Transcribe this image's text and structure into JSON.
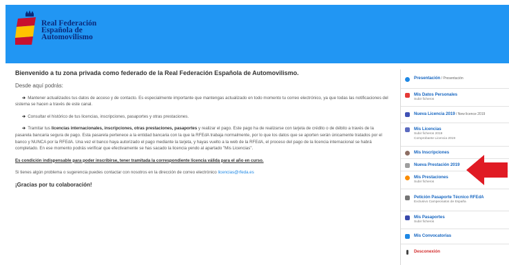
{
  "brand": {
    "line1": "Real Federación",
    "line2": "Española de",
    "line3": "Automovilismo"
  },
  "main": {
    "title": "Bienvenido a tu zona privada como federado de la Real Federación Española de Automovilismo.",
    "lead": "Desde aquí podrás:",
    "b1": "Mantener actualizados tus datos de acceso y de contacto. Es especialmente importante que mantengas actualizado en todo momento tu correo electrónico, ya que todas las notificaciones del sistema se hacen a través de este canal.",
    "b2": "Consultar el histórico de tus licencias, inscripciones, pasaportes y otras prestaciones.",
    "b3_pre": "Tramitar tus ",
    "b3_bold": "licencias internacionales, inscripciones, otras prestaciones, pasaportes",
    "b3_post": " y realizar el pago. Este pago ha de realizarse con tarjeta de crédito o de débito a través de la pasarela bancaria segura de pago. Esta pasarela pertenece a la entidad bancaria con la que la RFEdA trabaja normalmente, por lo que los datos que se aporten serán únicamente tratados por el banco y NUNCA por la RFEdA. Una vez el banco haya autorizado el pago mediante la tarjeta, y hayas vuelto a la web de la RFEdA, el proceso del pago de la licencia internacional se habrá completado. En ese momento podrás verificar que efectivamente se has sacado la licencia yendo al apartado \"Mis Licencias\".",
    "condition": "Es condición indispensable para poder inscribirse, tener tramitada la correspondiente licencia válida para el año en curso.",
    "contact_pre": "Si tienes algún problema o sugerencia puedes contactar con nosotros en la dirección de correo electrónico ",
    "contact_email": "licencias@rfeda.es",
    "thanks": "¡Gracias por tu colaboración!"
  },
  "sidebar": {
    "items": [
      {
        "title": "Presentación",
        "extra": " / Presentación",
        "sub1": "",
        "sub2": "",
        "icon_color": "#1e88e5"
      },
      {
        "title": "Mis Datos Personales",
        "extra": "",
        "sub1": "Subir ficheros",
        "sub2": "",
        "icon_color": "#e53935"
      },
      {
        "title": "Nueva Licencia 2019",
        "extra": " / New licence 2019",
        "sub1": "",
        "sub2": "",
        "icon_color": "#3f51b5"
      },
      {
        "title": "Mis Licencias",
        "extra": "",
        "sub1": "Subir ficheros 2019",
        "sub2": "Comprobante Licencia 2019",
        "icon_color": "#5c6bc0"
      },
      {
        "title": "Mis Inscripciones",
        "extra": "",
        "sub1": "",
        "sub2": "",
        "icon_color": "#8d6e63"
      },
      {
        "title": "Nueva Prestación 2019",
        "extra": "",
        "sub1": "",
        "sub2": "",
        "icon_color": "#9e9e9e"
      },
      {
        "title": "Mis Prestaciones",
        "extra": "",
        "sub1": "Subir ficheros",
        "sub2": "",
        "icon_color": "#fb8c00"
      },
      {
        "title": "Petición Pasaporte Técnico RFEdA",
        "extra": "",
        "sub1": "Exclusivo Campeonatos de España",
        "sub2": "",
        "icon_color": "#757575"
      },
      {
        "title": "Mis Pasaportes",
        "extra": "",
        "sub1": "Subir ficheros",
        "sub2": "",
        "icon_color": "#3949ab"
      },
      {
        "title": "Mis Convocatorias",
        "extra": "",
        "sub1": "",
        "sub2": "",
        "icon_color": "#1e88e5"
      },
      {
        "title": "Desconexión",
        "extra": "",
        "sub1": "",
        "sub2": "",
        "icon_color": "#444444"
      }
    ]
  },
  "colors": {
    "header": "#2196f3",
    "link": "#1565c0",
    "logout": "#d32f2f",
    "arrow": "#e01b24"
  }
}
